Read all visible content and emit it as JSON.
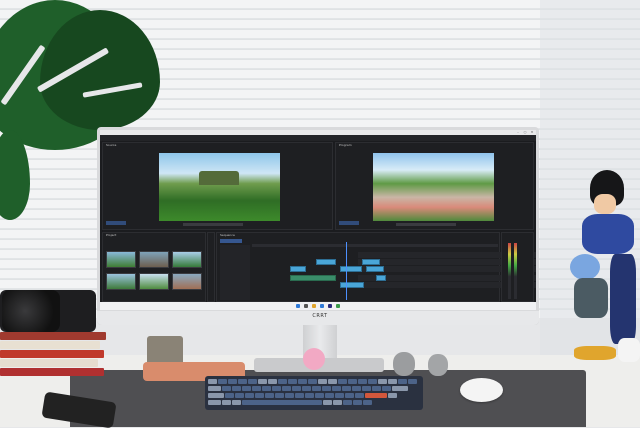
{
  "app": {
    "brand_label": "CRRT",
    "panels": {
      "source_tab": "Source",
      "program_tab": "Program",
      "project_tab": "Project",
      "timeline_tab": "Sequence"
    },
    "colors": {
      "ui_bg": "#1e1f22",
      "accent_timecode": "#4d90fe",
      "clip_video": "#4aa6d8",
      "clip_audio": "#3a8d6a"
    },
    "icons": [
      "close-icon",
      "minimize-icon",
      "maximize-icon",
      "play-icon",
      "windows-start-icon"
    ]
  }
}
